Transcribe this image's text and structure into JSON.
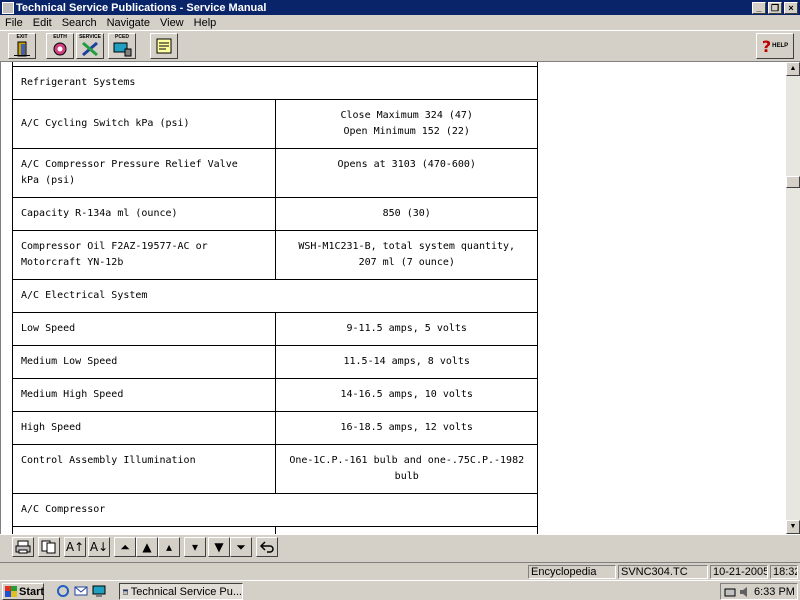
{
  "window": {
    "title": "Technical Service Publications - Service Manual",
    "min_label": "_",
    "restore_label": "❐",
    "close_label": "×"
  },
  "menu": [
    "File",
    "Edit",
    "Search",
    "Navigate",
    "View",
    "Help"
  ],
  "toolbar": {
    "exit_label": "EXIT",
    "euth_label": "EUTH",
    "service_label": "SERVICE",
    "pced_label": "PCED",
    "help_label": "HELP",
    "help_glyph": "?"
  },
  "table": {
    "rows": [
      {
        "kind": "header",
        "label": "Refrigerant Systems"
      },
      {
        "kind": "pair",
        "label": "A/C Cycling Switch kPa (psi)",
        "value_lines": [
          "Close Maximum 324 (47)",
          "Open Minimum 152 (22)"
        ]
      },
      {
        "kind": "pair",
        "label_lines": [
          "A/C Compressor Pressure Relief Valve",
          "kPa (psi)"
        ],
        "value_lines": [
          "Opens at 3103 (470-600)"
        ]
      },
      {
        "kind": "pair",
        "label": "Capacity R-134a ml (ounce)",
        "value_lines": [
          "850 (30)"
        ]
      },
      {
        "kind": "pair",
        "label_lines": [
          "Compressor Oil F2AZ-19577-AC or",
          "Motorcraft YN-12b"
        ],
        "value_lines": [
          "WSH-M1C231-B, total system quantity,",
          "207 ml (7 ounce)"
        ]
      },
      {
        "kind": "header",
        "label": "A/C Electrical System"
      },
      {
        "kind": "pair",
        "label": "Low Speed",
        "value_lines": [
          "9-11.5 amps, 5 volts"
        ]
      },
      {
        "kind": "pair",
        "label": "Medium Low Speed",
        "value_lines": [
          "11.5-14 amps, 8 volts"
        ]
      },
      {
        "kind": "pair",
        "label": "Medium High Speed",
        "value_lines": [
          "14-16.5 amps, 10 volts"
        ]
      },
      {
        "kind": "pair",
        "label": "High Speed",
        "value_lines": [
          "16-18.5 amps, 12 volts"
        ]
      },
      {
        "kind": "pair",
        "label": "Control Assembly Illumination",
        "value_lines": [
          "One-1C.P.-161 bulb and one-.75C.P.-1982",
          "bulb"
        ]
      },
      {
        "kind": "header",
        "label": "A/C Compressor"
      }
    ]
  },
  "scrollbar": {
    "up": "▲",
    "down": "▼"
  },
  "nav": {
    "print": "print-icon",
    "copy": "copy-icon",
    "font_up": "A↑",
    "font_down": "A↓",
    "first": "⏶",
    "prev_section": "▲",
    "prev": "▴",
    "next": "▾",
    "next_section": "▼",
    "last": "⏷",
    "back": "back-icon"
  },
  "status": {
    "section": "Encyclopedia",
    "doc_id": "SVNC304.TC",
    "date": "10-21-2005",
    "time": "18:32"
  },
  "taskbar": {
    "start_label": "Start",
    "task_label": "Technical Service Pu...",
    "clock": "6:33 PM"
  }
}
